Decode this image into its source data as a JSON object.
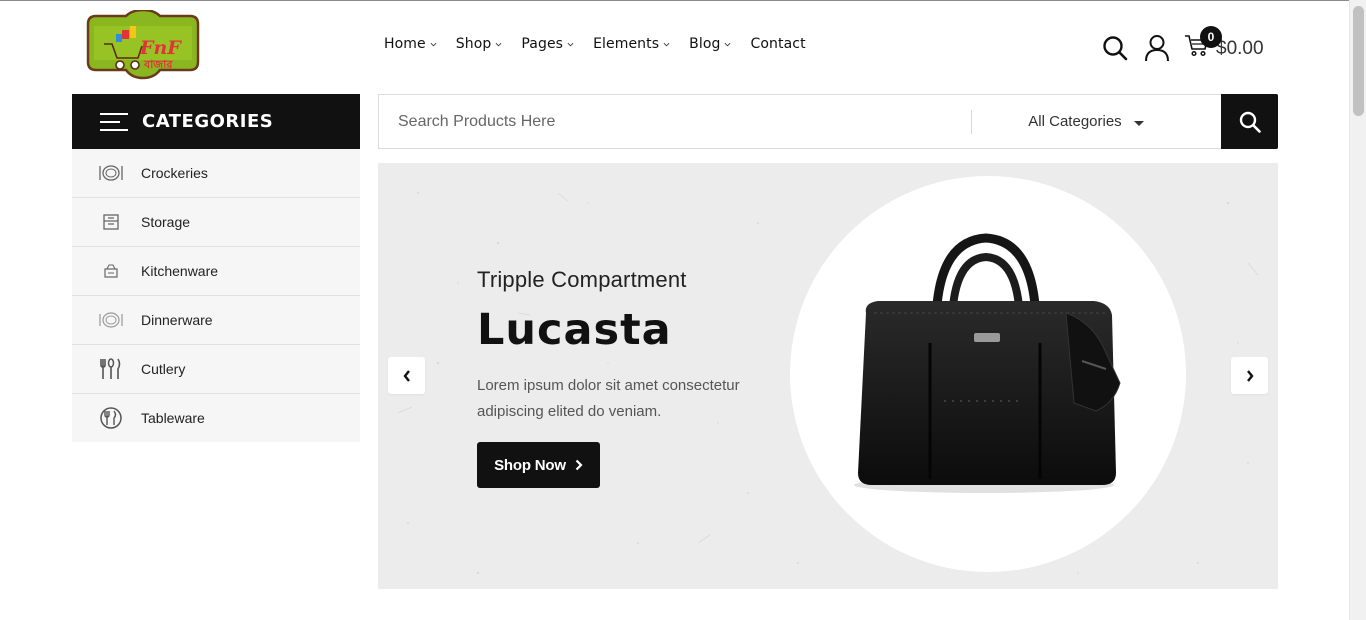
{
  "header": {
    "logo_text": "FnF",
    "logo_subtext": "বাজার",
    "nav": [
      {
        "label": "Home",
        "has_dropdown": true
      },
      {
        "label": "Shop",
        "has_dropdown": true
      },
      {
        "label": "Pages",
        "has_dropdown": true
      },
      {
        "label": "Elements",
        "has_dropdown": true
      },
      {
        "label": "Blog",
        "has_dropdown": true
      },
      {
        "label": "Contact",
        "has_dropdown": false
      }
    ],
    "icons": [
      "search-icon",
      "user-icon",
      "cart-icon"
    ],
    "cart_count": "0",
    "cart_total": "$0.00"
  },
  "sidebar": {
    "title": "CATEGORIES",
    "items": [
      {
        "label": "Crockeries",
        "icon": "crockery-icon"
      },
      {
        "label": "Storage",
        "icon": "storage-icon"
      },
      {
        "label": "Kitchenware",
        "icon": "kitchenware-icon"
      },
      {
        "label": "Dinnerware",
        "icon": "dinnerware-icon"
      },
      {
        "label": "Cutlery",
        "icon": "cutlery-icon"
      },
      {
        "label": "Tableware",
        "icon": "tableware-icon"
      }
    ]
  },
  "search": {
    "placeholder": "Search Products Here",
    "category_selected": "All Categories"
  },
  "hero": {
    "subtitle": "Tripple Compartment",
    "title": "Lucasta",
    "description": "Lorem ipsum dolor sit amet consectetur adipiscing elited do veniam.",
    "button_label": "Shop Now"
  },
  "colors": {
    "accent": "#111111",
    "hero_bg": "#ececec",
    "sidebar_bg": "#f6f6f6"
  }
}
